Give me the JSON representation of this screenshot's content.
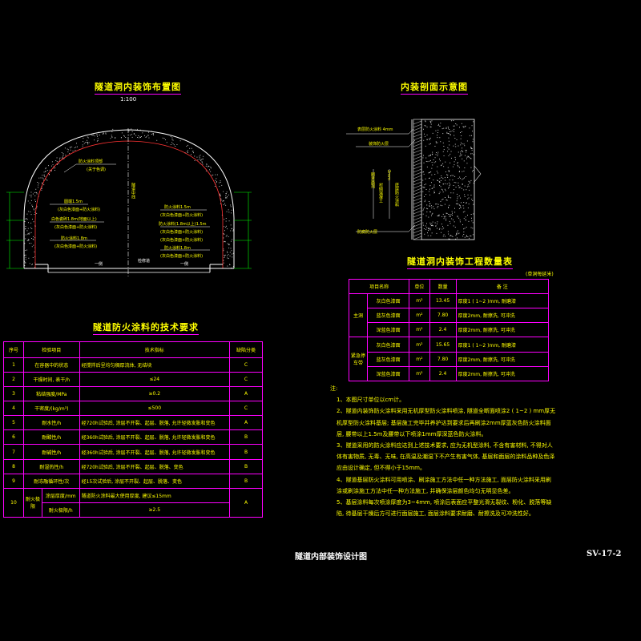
{
  "left_drawing": {
    "title": "隧道洞内装饰布置图",
    "scale": "1:100",
    "labels": {
      "fireproof_top": "防火涂料顶部",
      "fireproof_top_sub": "(关于色调)",
      "cap_left": "圆端1.5m",
      "cap_left_sub": "(灰白色漆面+防火涂料)",
      "side_left": "白色瓷砖1.8m(地面以上)",
      "side_left_sub": "(灰白色漆面+防火涂料)",
      "mid_left": "防火涂料1.8m",
      "mid_left_sub": "(灰白色漆面+防火涂料)",
      "right_a": "防火涂料1.5m",
      "right_a_sub": "(灰白色漆面+防火涂料)",
      "right_b": "(灰白色漆面+防火涂料)",
      "right_c": "防火涂料(1.8m以上)1.5m",
      "right_c_sub": "(灰白色漆面+防火涂料)",
      "right_d": "防火涂料1.8m",
      "right_d_sub": "(灰白色漆面+防火涂料)",
      "centerline": "隧道中线",
      "bottom_left": "一侧",
      "bottom_right": "检修道",
      "bottom_right2": "一侧"
    }
  },
  "right_drawing": {
    "title": "内装剖面示意图",
    "labels": {
      "l1": "表层防火涂料 4mm",
      "l2": "装饰防火层",
      "l3": "刷界面剂",
      "l4": "2mm",
      "l5": "衬砌混凝土",
      "l6": "底层防火涂料",
      "l7": "防腐防火层"
    }
  },
  "quantity_table": {
    "title": "隧道洞内装饰工程数量表",
    "subtitle": "(单洞每延米)",
    "headers": [
      "项目名称",
      "单位",
      "数量",
      "备 注"
    ],
    "groups": [
      {
        "name": "主洞",
        "rows": [
          [
            "灰白色漆面",
            "m²",
            "13.45",
            "厚度1 ( 1~2 )mm, 耐磨漆"
          ],
          [
            "蓝灰色漆面",
            "m²",
            "7.80",
            "厚度2mm, 耐擦洗, 可冲洗"
          ],
          [
            "深蓝色漆面",
            "m²",
            "2.4",
            "厚度2mm, 耐擦洗, 可冲洗"
          ]
        ]
      },
      {
        "name": "紧急停车带",
        "rows": [
          [
            "灰白色漆面",
            "m²",
            "15.65",
            "厚度1 ( 1~2 )mm, 耐磨漆"
          ],
          [
            "蓝灰色漆面",
            "m²",
            "7.80",
            "厚度2mm, 耐擦洗, 可冲洗"
          ],
          [
            "深蓝色漆面",
            "m²",
            "2.4",
            "厚度2mm, 耐擦洗, 可冲洗"
          ]
        ]
      }
    ]
  },
  "tech_table": {
    "title": "隧道防火涂料的技术要求",
    "headers": [
      "序号",
      "检验项目",
      "技术指标",
      "缺陷分类"
    ],
    "rows": [
      [
        "1",
        "在容器中的状态",
        "经搅拌后呈均匀稠厚流体, 无结块",
        "C"
      ],
      [
        "2",
        "干燥时间, 表干/h",
        "≤24",
        "C"
      ],
      [
        "3",
        "粘结强度/MPa",
        "≥0.2",
        "A"
      ],
      [
        "4",
        "干密度/(kg/m³)",
        "≤500",
        "C"
      ],
      [
        "5",
        "耐水性/h",
        "经720h试验后, 涂层不开裂、起层、脱落, 允许轻微发胀和变色",
        "A"
      ],
      [
        "6",
        "耐酸性/h",
        "经360h试验后, 涂层不开裂、起层、脱落, 允许轻微发胀和变色",
        "B"
      ],
      [
        "7",
        "耐碱性/h",
        "经360h试验后, 涂层不开裂、起层、脱落, 允许轻微发胀和变色",
        "B"
      ],
      [
        "8",
        "耐湿热性/h",
        "经720h试验后, 涂层不开裂、起层、脱落、变色",
        "B"
      ],
      [
        "9",
        "耐冻融循环性/次",
        "经15次试验后, 涂层不开裂、起层、脱落、变色",
        "B"
      ]
    ],
    "row10": {
      "no": "10",
      "item": "耐火极限",
      "sub1": "涂层厚度/mm",
      "sub1_value": "隧道防火涂料最大使用厚度, 建议≤15mm",
      "sub2": "耐火极限/h",
      "sub2_value": "≥2.5",
      "class": "A"
    }
  },
  "notes": {
    "heading": "注:",
    "items": [
      "1、本图尺寸单位以cm计。",
      "2、隧道内装饰防火涂料采用无机厚型防火涂料喷涂, 隧道全断面喷涂2 ( 1~2 ) mm厚无机厚型防火涂料基层; 基层施工完毕并养护达到要求后再刷涂2mm厚蓝灰色防火涂料面层, 腰带以上1.5m及腰带以下喷涂1mm厚深蓝色防火涂料。",
      "3、隧道采用的防火涂料应达到上述技术要求, 应为无机型涂料, 不含有害材料, 不得对人体有害物质, 无毒、无味, 在高温及潮湿下不产生有害气体, 基层和面层的涂料品种及色泽应由设计确定, 但不得小于15mm。",
      "4、隧道基层防火涂料可用喷涂、刷涂施工方法中任一种方法施工, 面层防火涂料采用刷涂或刷涂施工方法中任一种方法施工, 并确保涂层颜色均匀无明显色差。",
      "5、基层涂料每次喷涂厚度为3~4mm, 喷涂后表面应平整光滑无裂纹、粉化、脱落等缺陷, 待基层干燥后方可进行面层施工, 面层涂料要求耐磨、耐擦洗及可冲洗性好。"
    ]
  },
  "footer": {
    "drawing_title": "隧道内部装饰设计图",
    "drawing_no": "SV-17-2"
  },
  "colors": {
    "background": "#000000",
    "text": "#ffff00",
    "lines": "#ff00ff",
    "green": "#00ff00",
    "cyan": "#00ffff"
  }
}
